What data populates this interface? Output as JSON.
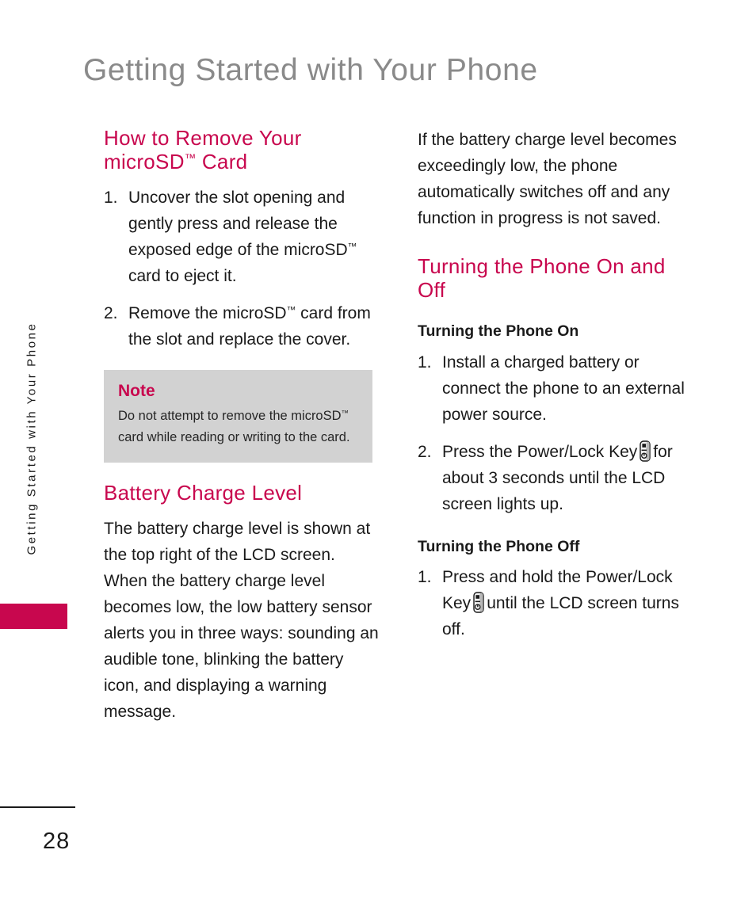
{
  "page": {
    "title": "Getting Started with Your Phone",
    "number": "28",
    "running_head": "Getting Started with Your Phone",
    "accent_color": "#c8074e",
    "title_color": "#8a8a8a",
    "note_background": "#d2d2d2"
  },
  "left_column": {
    "heading_line1": "How to Remove Your",
    "heading_line2_pre": "microSD",
    "heading_tm": "™",
    "heading_line2_post": " Card",
    "steps": [
      {
        "marker": "1.",
        "text_pre": "Uncover the slot opening and gently press and release the exposed edge of the microSD",
        "tm": "™",
        "text_post": " card to eject it."
      },
      {
        "marker": "2.",
        "text_pre": "Remove the microSD",
        "tm": "™",
        "text_post": " card from the slot and replace the cover."
      }
    ],
    "note": {
      "title": "Note",
      "text_pre": "Do not attempt to remove the microSD",
      "tm": "™",
      "text_post": " card while reading or writing to the card."
    },
    "battery_heading": "Battery Charge Level",
    "battery_body": "The battery charge level is shown at the top right of the LCD screen. When the battery charge level becomes low, the low battery sensor alerts you in three ways: sounding an audible tone, blinking the battery icon, and displaying a warning message."
  },
  "right_column": {
    "intro_body": "If the battery charge level becomes exceedingly low, the phone automatically switches off and any function in progress is not saved.",
    "heading_line1": "Turning the Phone On and",
    "heading_line2": "Off",
    "subheading_on": "Turning the Phone On",
    "steps_on": [
      {
        "marker": "1.",
        "text": "Install a charged battery or connect the phone to an external power source."
      },
      {
        "marker": "2.",
        "text_pre": "Press the Power/Lock Key",
        "icon": "power-lock-key-icon",
        "text_post": "for about 3 seconds until the LCD screen lights up."
      }
    ],
    "subheading_off": "Turning the Phone Off",
    "steps_off": [
      {
        "marker": "1.",
        "text_pre": "Press and hold the Power/Lock Key",
        "icon": "power-lock-key-icon",
        "text_post": "until the LCD screen turns off."
      }
    ]
  }
}
